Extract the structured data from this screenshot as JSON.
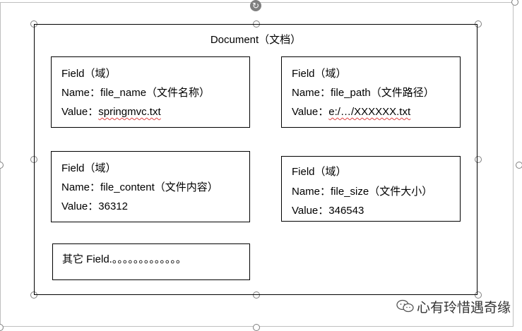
{
  "document": {
    "title": "Document（文档）"
  },
  "fields": [
    {
      "field_label": "Field（域）",
      "name_label": "Name：",
      "name_value": "file_name（文件名称）",
      "value_label": "Value：",
      "value_value": "springmvc.txt"
    },
    {
      "field_label": "Field（域）",
      "name_label": "Name：",
      "name_value": "file_path（文件路径）",
      "value_label": "Value：",
      "value_value": "e:/…/XXXXXX.txt"
    },
    {
      "field_label": "Field（域）",
      "name_label": "Name：",
      "name_value": "file_content（文件内容）",
      "value_label": "Value：",
      "value_value": "36312"
    },
    {
      "field_label": "Field（域）",
      "name_label": "Name：",
      "name_value": "file_size（文件大小）",
      "value_label": "Value：",
      "value_value": "346543"
    }
  ],
  "other": {
    "text": "其它 Field.。。。。。。。。。。。。。"
  },
  "watermark": {
    "text": "心有玲惜遇奇缘",
    "icon": "wechat-icon"
  },
  "colors": {
    "border": "#000000",
    "handle": "#7f7f7f",
    "spellcheck": "#e04040"
  }
}
